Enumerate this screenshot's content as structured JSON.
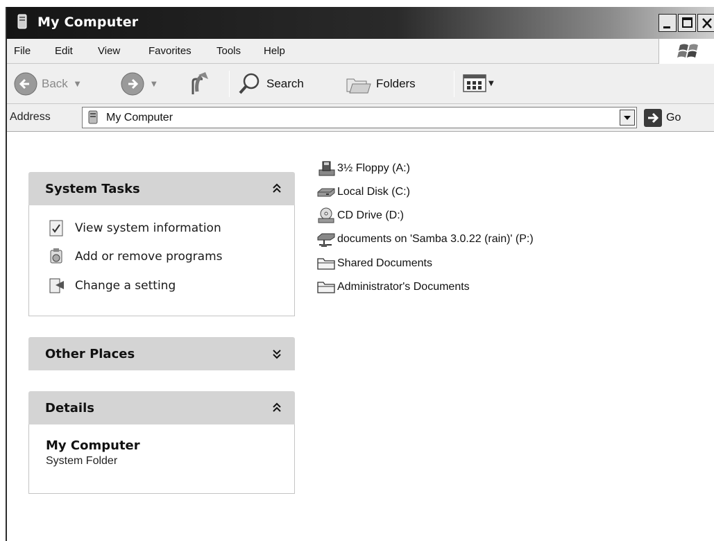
{
  "window": {
    "title": "My Computer"
  },
  "title_buttons": [
    "minimize",
    "maximize",
    "close"
  ],
  "menu": [
    {
      "label": "File"
    },
    {
      "label": "Edit"
    },
    {
      "label": "View"
    },
    {
      "label": "Favorites"
    },
    {
      "label": "Tools"
    },
    {
      "label": "Help"
    }
  ],
  "toolbar": {
    "back_label": "Back",
    "search_label": "Search",
    "folders_label": "Folders"
  },
  "address": {
    "label": "Address",
    "value": "My Computer",
    "go_label": "Go"
  },
  "system_tasks": {
    "title": "System Tasks",
    "items": [
      {
        "label": "View system information",
        "icon": "system-info-icon"
      },
      {
        "label": "Add or remove programs",
        "icon": "add-remove-programs-icon"
      },
      {
        "label": "Change a setting",
        "icon": "control-panel-icon"
      }
    ]
  },
  "other_places": {
    "title": "Other Places"
  },
  "details": {
    "title": "Details",
    "name": "My Computer",
    "type": "System Folder"
  },
  "drives": [
    {
      "label": "3½ Floppy (A:)",
      "icon": "floppy-drive-icon"
    },
    {
      "label": "Local Disk (C:)",
      "icon": "hard-disk-icon"
    },
    {
      "label": "CD Drive (D:)",
      "icon": "cd-drive-icon"
    },
    {
      "label": "documents on 'Samba 3.0.22 (rain)' (P:)",
      "icon": "network-drive-icon"
    },
    {
      "label": "Shared Documents",
      "icon": "folder-icon"
    },
    {
      "label": "Administrator's Documents",
      "icon": "folder-icon"
    }
  ]
}
